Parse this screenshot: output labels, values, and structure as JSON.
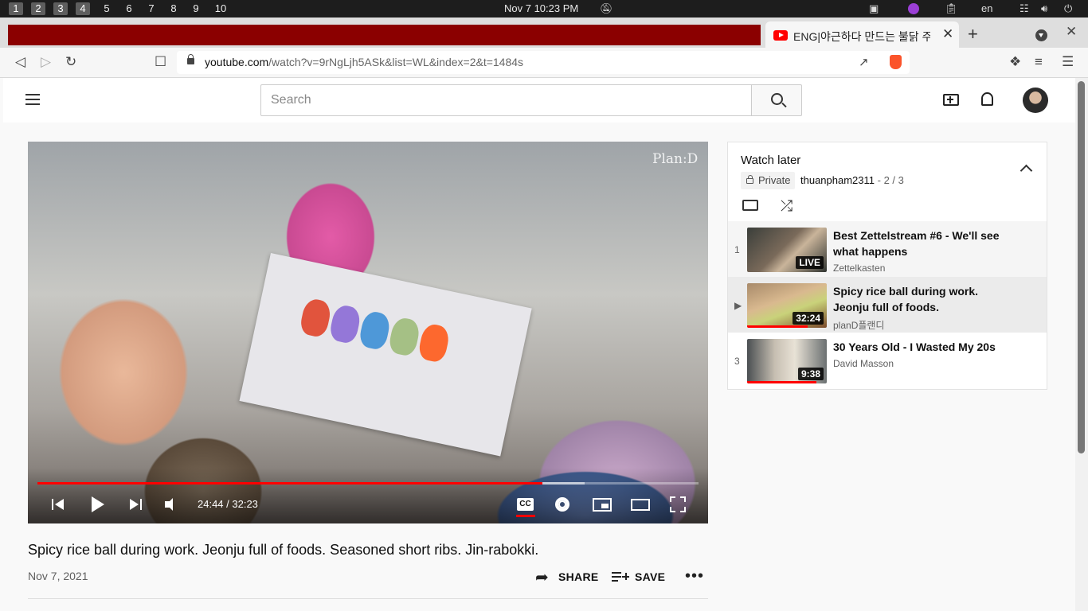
{
  "os": {
    "workspaces": [
      "1",
      "2",
      "3",
      "4",
      "5",
      "6",
      "7",
      "8",
      "9",
      "10"
    ],
    "active_workspaces": [
      0,
      1,
      2,
      3
    ],
    "clock": "Nov 7  10:23 PM",
    "lang": "en"
  },
  "browser": {
    "tab_title": "ENG|야근하다 만드는 불닭 주",
    "url_domain": "youtube.com",
    "url_path": "/watch?v=9rNgLjh5ASk&list=WL&index=2&t=1484s"
  },
  "youtube": {
    "search_placeholder": "Search"
  },
  "player": {
    "watermark": "Plan:D",
    "time": "24:44 / 32:23",
    "played_fraction": 0.764,
    "buffered_fraction": 0.828,
    "cc_label": "CC"
  },
  "video": {
    "title": "Spicy rice ball during work. Jeonju full of foods. Seasoned short ribs. Jin-rabokki.",
    "date": "Nov 7, 2021",
    "share_label": "SHARE",
    "save_label": "SAVE",
    "more_label": "•••"
  },
  "playlist": {
    "title": "Watch later",
    "privacy": "Private",
    "owner": "thuanpham2311",
    "position": " - 2 / 3",
    "items": [
      {
        "index": "1",
        "title": "Best Zettelstream #6 - We'll see what happens",
        "channel": "Zettelkasten",
        "badge": "LIVE",
        "watched_fraction": 0
      },
      {
        "index": "▶",
        "title": "Spicy rice ball during work. Jeonju full of foods. Seasoned…",
        "channel": "planD플랜디",
        "badge": "32:24",
        "watched_fraction": 0.76
      },
      {
        "index": "3",
        "title": "30 Years Old - I Wasted My 20s",
        "channel": "David Masson",
        "badge": "9:38",
        "watched_fraction": 0.87
      }
    ]
  },
  "colors": {
    "accent": "#ff0000",
    "tab_red": "#8b0000"
  }
}
